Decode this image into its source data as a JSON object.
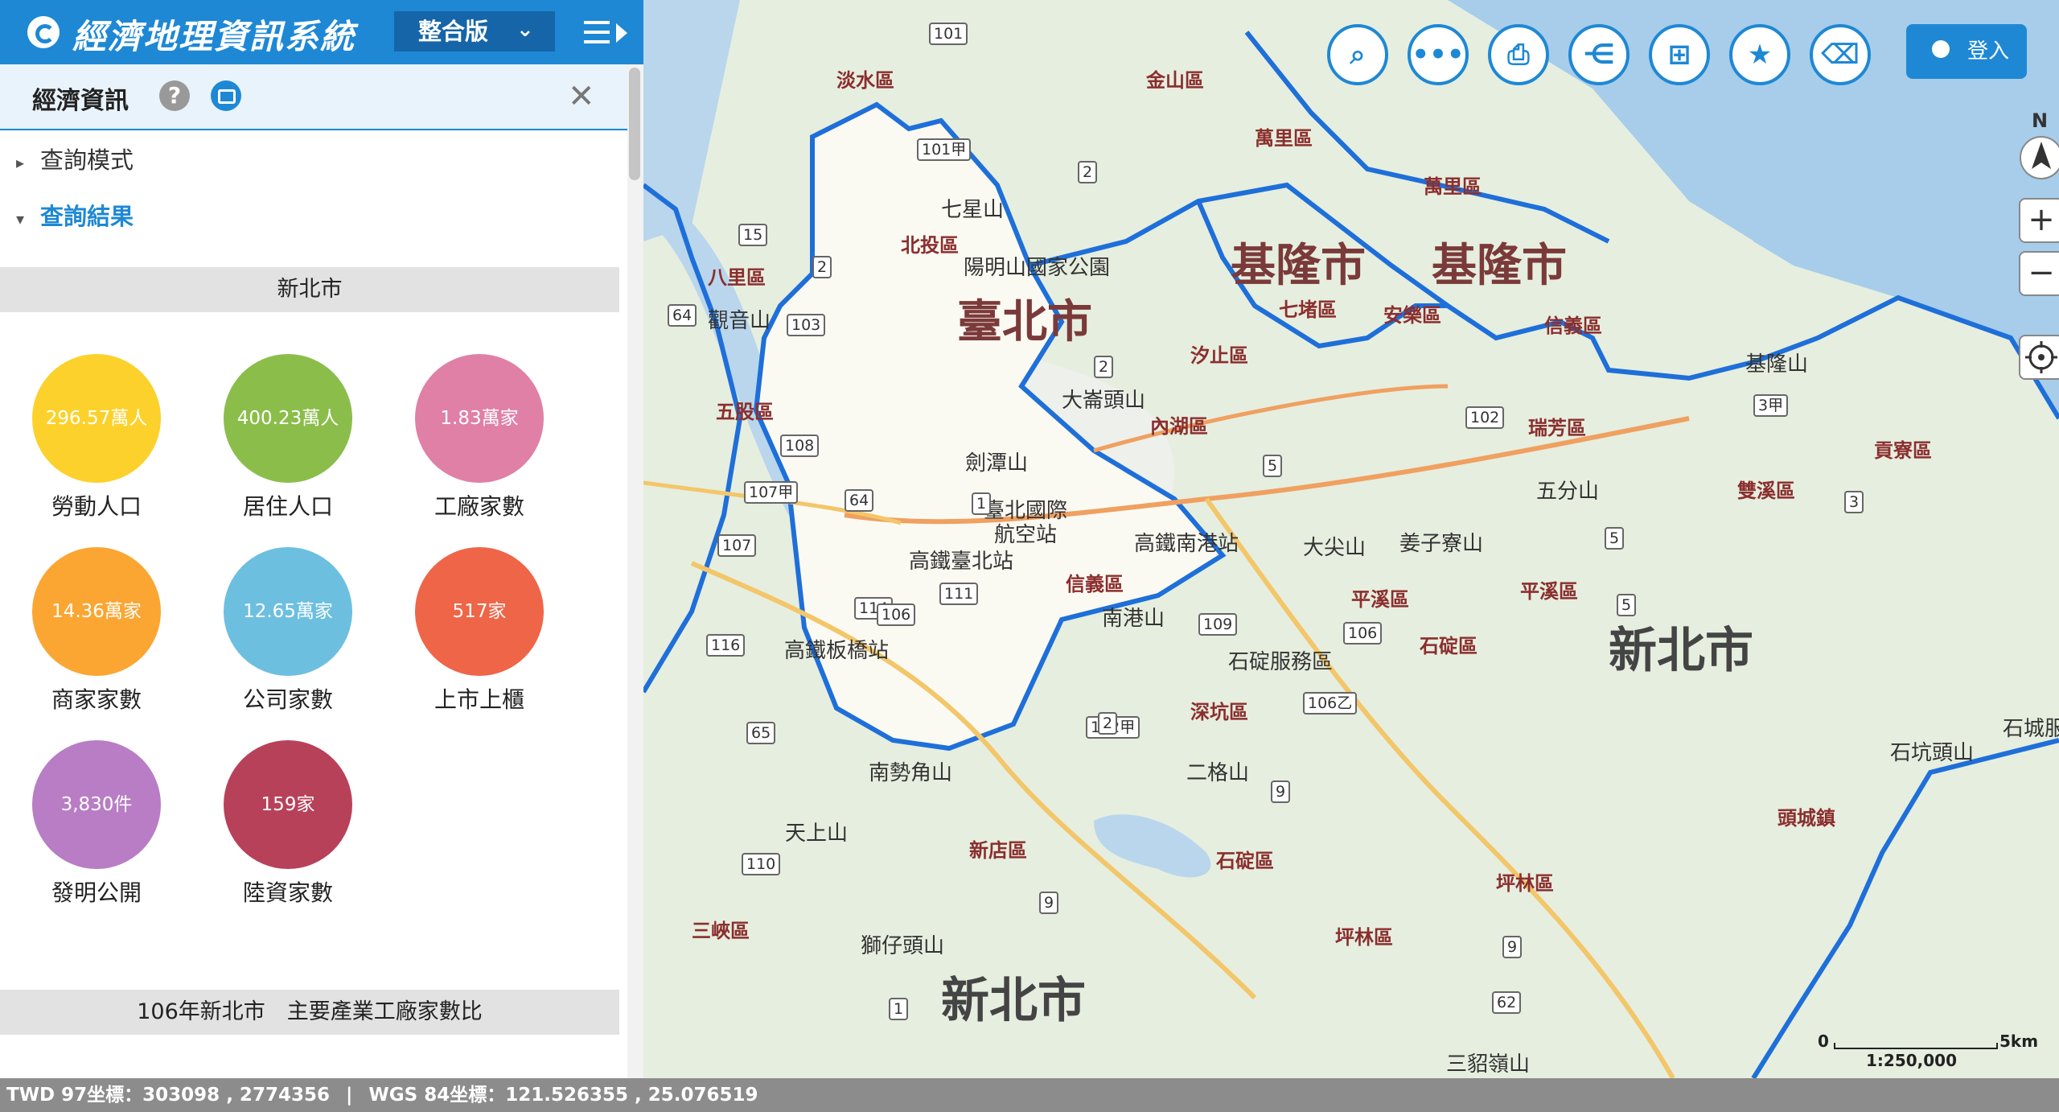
{
  "header": {
    "title": "經濟地理資訊系統",
    "edition": "整合版",
    "colors": {
      "brand": "#1e88d4",
      "brand_dark": "#1565a8"
    }
  },
  "panel": {
    "section_title": "經濟資訊",
    "tree": [
      {
        "label": "查詢模式",
        "expanded": false
      },
      {
        "label": "查詢結果",
        "expanded": true
      }
    ],
    "city": "新北市",
    "stats": [
      {
        "value": "296.57萬人",
        "label": "勞動人口",
        "color": "#fdd12b"
      },
      {
        "value": "400.23萬人",
        "label": "居住人口",
        "color": "#8bbd4b"
      },
      {
        "value": "1.83萬家",
        "label": "工廠家數",
        "color": "#e080a6"
      },
      {
        "value": "14.36萬家",
        "label": "商家家數",
        "color": "#fba632"
      },
      {
        "value": "12.65萬家",
        "label": "公司家數",
        "color": "#6dbfe0"
      },
      {
        "value": "517家",
        "label": "上市上櫃",
        "color": "#ef6548"
      },
      {
        "value": "3,830件",
        "label": "發明公開",
        "color": "#b87dc4"
      },
      {
        "value": "159家",
        "label": "陸資家數",
        "color": "#b8415a"
      }
    ],
    "chart_title": "106年新北市　主要產業工廠家數比"
  },
  "map": {
    "toolbar": [
      {
        "name": "search-icon",
        "glyph": "⌕"
      },
      {
        "name": "more-icon",
        "glyph": "•••"
      },
      {
        "name": "print-icon",
        "glyph": "⎙"
      },
      {
        "name": "share-icon",
        "glyph": "⋲"
      },
      {
        "name": "map-book-icon",
        "glyph": "⊞"
      },
      {
        "name": "star-icon",
        "glyph": "★"
      },
      {
        "name": "eraser-icon",
        "glyph": "⌫"
      }
    ],
    "login_label": "登入",
    "north_label": "N",
    "zoom_in": "+",
    "zoom_out": "−",
    "scale": {
      "start": "0",
      "end": "5km",
      "ratio": "1:250,000"
    },
    "labels": {
      "taipei": "臺北市",
      "keelung_1": "基隆市",
      "keelung_2": "基隆市",
      "newtaipei_1": "新北市",
      "newtaipei_2": "新北市",
      "tamsui": "淡水區",
      "jinshan": "金山區",
      "wanli_1": "萬里區",
      "wanli_2": "萬里區",
      "beitou": "北投區",
      "yangming": "陽明山國家公園",
      "qixing": "七星山",
      "bali": "八里區",
      "guanyin": "觀音山",
      "wugu": "五股區",
      "neihu": "內湖區",
      "xizhi": "汐止區",
      "qidu": "七堵區",
      "anle": "安樂區",
      "xinyi_kl": "信義區",
      "dalun": "大崙頭山",
      "jiantan": "劍潭山",
      "songshan_airport": "臺北國際航空站",
      "hsr_nangang": "高鐵南港站",
      "hsr_taipei": "高鐵臺北站",
      "xinyi": "信義區",
      "nangang_mt": "南港山",
      "hsr_banqiao": "高鐵板橋站",
      "pingxi_1": "平溪區",
      "pingxi_2": "平溪區",
      "shiding": "石碇區",
      "shiding_svc": "石碇服務區",
      "shenkeng": "深坑區",
      "ruifang": "瑞芳區",
      "shuangxi": "雙溪區",
      "gongliao": "貢寮區",
      "keelung_mt": "基隆山",
      "wufen": "五分山",
      "jiangzi": "姜子寮山",
      "dajian": "大尖山",
      "erge": "二格山",
      "nanshijiao": "南勢角山",
      "tianshang": "天上山",
      "xindian": "新店區",
      "shiding_2": "石碇區",
      "pinglin_1": "坪林區",
      "pinglin_2": "坪林區",
      "sanxia": "三峽區",
      "shizai": "獅仔頭山",
      "toucheng": "頭城鎮",
      "shikeng": "石坑頭山",
      "shicheng": "石城服",
      "sandiao": "三貂嶺山"
    },
    "routes": [
      "101",
      "101甲",
      "2",
      "15",
      "2",
      "64",
      "103",
      "108",
      "107甲",
      "64",
      "1",
      "107",
      "111",
      "114",
      "116",
      "65",
      "110",
      "9",
      "9",
      "9",
      "109",
      "106",
      "106乙",
      "5",
      "5",
      "62",
      "1",
      "2",
      "102",
      "102甲",
      "106",
      "2",
      "3甲",
      "3",
      "5"
    ]
  },
  "status": {
    "twd97": "TWD 97坐標：303098 , 2774356",
    "sep": "|",
    "wgs84": "WGS 84坐標：121.526355 , 25.076519"
  }
}
